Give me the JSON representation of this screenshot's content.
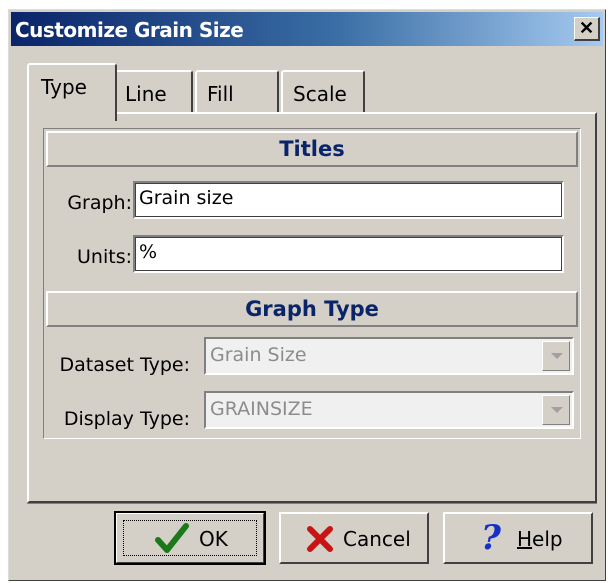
{
  "window": {
    "title": "Customize Grain Size",
    "close_label": "✕"
  },
  "tabs": [
    {
      "label": "Type",
      "active": true
    },
    {
      "label": "Line",
      "active": false
    },
    {
      "label": "Fill",
      "active": false
    },
    {
      "label": "Scale",
      "active": false
    }
  ],
  "titles_section": {
    "header": "Titles",
    "graph_label": "Graph:",
    "graph_value": "Grain size",
    "units_label": "Units:",
    "units_value": "%"
  },
  "graph_type_section": {
    "header": "Graph Type",
    "dataset_type_label": "Dataset Type:",
    "dataset_type_value": "Grain Size",
    "display_type_label": "Display Type:",
    "display_type_value": "GRAINSIZE"
  },
  "buttons": {
    "ok_label": "OK",
    "cancel_label": "Cancel",
    "help_label_hotkey": "H",
    "help_label_rest": "elp"
  },
  "colors": {
    "titlebar_start": "#0a246a",
    "titlebar_end": "#a6caf0",
    "section_header_text": "#0a246a",
    "dialog_face": "#d4d0c8",
    "ok_check": "#1a7a1a",
    "cancel_x": "#c81414",
    "help_question": "#1432c8"
  }
}
